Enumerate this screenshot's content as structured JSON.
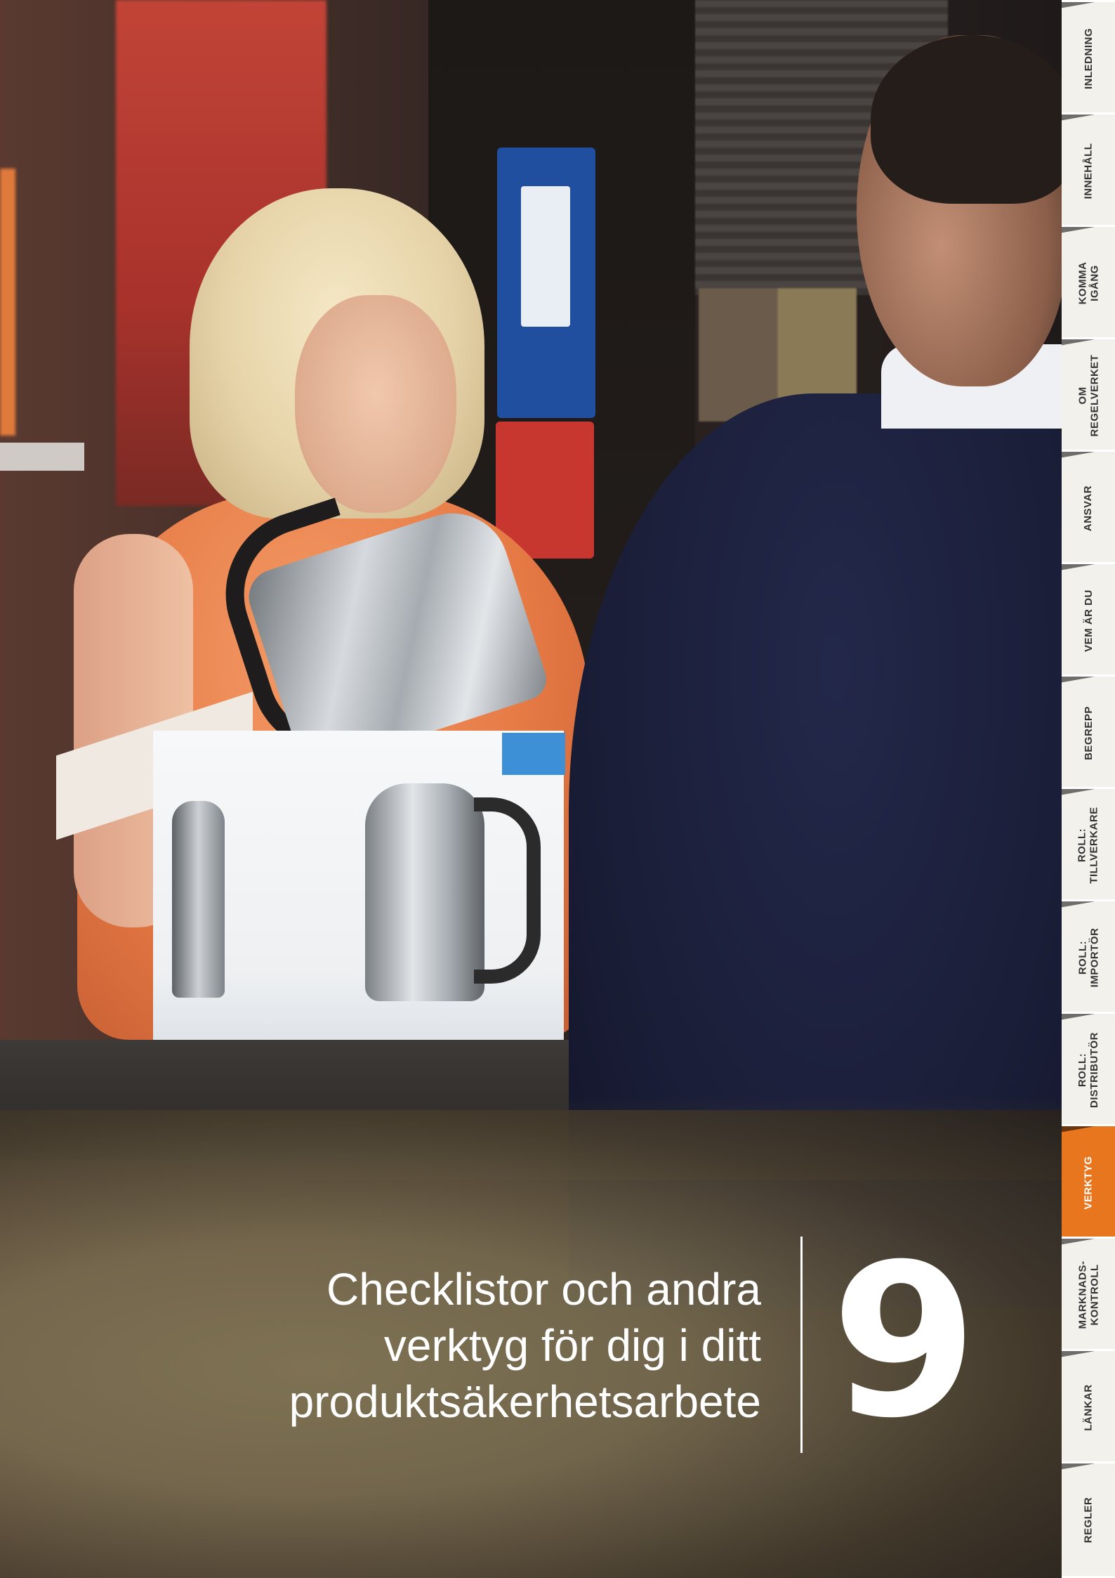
{
  "title": {
    "line1": "Checklistor och andra",
    "line2": "verktyg för dig i ditt",
    "line3": "produktsäkerhetsarbete"
  },
  "chapter_number": "9",
  "nav": {
    "active_color": "#e8761e",
    "tabs": [
      {
        "label": "INLEDNING"
      },
      {
        "label": "INNEHÅLL"
      },
      {
        "label": "KOMMA\nIGÅNG"
      },
      {
        "label": "OM\nREGELVERKET"
      },
      {
        "label": "ANSVAR"
      },
      {
        "label": "VEM ÄR DU"
      },
      {
        "label": "BEGREPP"
      },
      {
        "label": "ROLL:\nTILLVERKARE"
      },
      {
        "label": "ROLL:\nIMPORTÖR"
      },
      {
        "label": "ROLL:\nDISTRIBUTÖR"
      },
      {
        "label": "VERKTYG",
        "active": true
      },
      {
        "label": "MARKNADS-\nKONTROLL"
      },
      {
        "label": "LÄNKAR"
      },
      {
        "label": "REGLER"
      }
    ]
  }
}
